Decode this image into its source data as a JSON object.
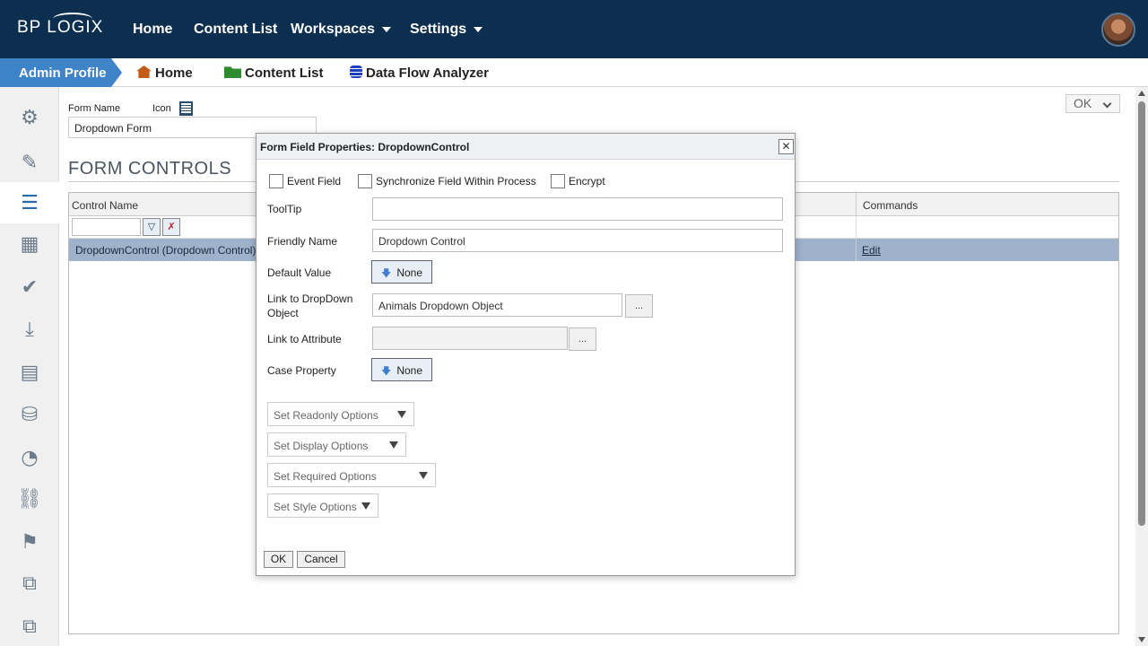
{
  "topnav": {
    "logo": "BP LOGIX",
    "items": [
      "Home",
      "Content List",
      "Workspaces",
      "Settings"
    ]
  },
  "breadcrumb": {
    "active": "Admin Profile",
    "items": [
      "Home",
      "Content List",
      "Data Flow Analyzer"
    ]
  },
  "sidebar": {
    "icons": [
      "gears-icon",
      "edit-icon",
      "list-icon",
      "table-icon",
      "check-icon",
      "download-icon",
      "form-list-icon",
      "database-add-icon",
      "dashboard-icon",
      "link-icon",
      "flag-icon",
      "copy-icon",
      "clone-icon"
    ],
    "active_index": 2
  },
  "form": {
    "name_label": "Form Name",
    "icon_label": "Icon",
    "name_value": "Dropdown Form",
    "ok_label": "OK",
    "section_title": "FORM CONTROLS"
  },
  "grid": {
    "columns": [
      "Control Name",
      "Commands"
    ],
    "rows": [
      {
        "control_name": "DropdownControl (Dropdown Control)",
        "command": "Edit"
      }
    ]
  },
  "dialog": {
    "title": "Form Field Properties: DropdownControl",
    "checkboxes": [
      "Event Field",
      "Synchronize Field Within Process",
      "Encrypt"
    ],
    "tooltip_label": "ToolTip",
    "tooltip_value": "",
    "friendly_label": "Friendly Name",
    "friendly_value": "Dropdown Control",
    "default_label": "Default Value",
    "default_value": "None",
    "link_dropdown_label": "Link to DropDown Object",
    "link_dropdown_value": "Animals Dropdown Object",
    "link_attr_label": "Link to Attribute",
    "link_attr_value": "",
    "case_label": "Case Property",
    "case_value": "None",
    "dots": "...",
    "option_dropdowns": [
      "Set Readonly Options",
      "Set Display Options",
      "Set Required Options",
      "Set Style Options"
    ],
    "ok": "OK",
    "cancel": "Cancel",
    "close": "✕"
  }
}
